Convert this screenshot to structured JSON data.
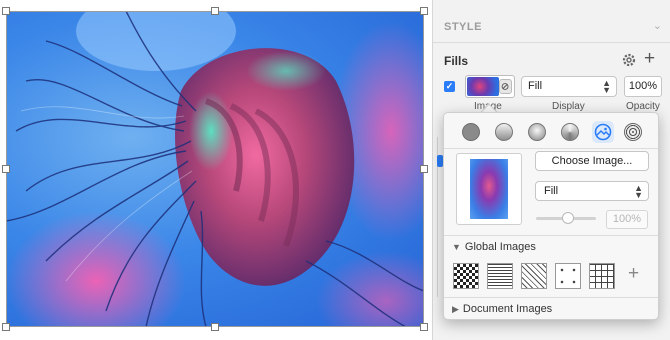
{
  "inspector": {
    "section_title": "STYLE",
    "fills_title": "Fills",
    "fill_row": {
      "enabled": true,
      "type_value": "Fill",
      "opacity_value": "100%",
      "label_image": "Image",
      "label_display": "Display",
      "label_opacity": "Opacity"
    }
  },
  "popover": {
    "fill_types": [
      "solid-color",
      "linear-gradient",
      "radial-gradient",
      "angular-gradient",
      "image-fill",
      "noise-fill"
    ],
    "selected_fill_type": "image-fill",
    "choose_image_label": "Choose Image...",
    "display_mode": "Fill",
    "opacity_placeholder": "100%",
    "global_images_label": "Global Images",
    "document_images_label": "Document Images"
  },
  "colors": {
    "accent": "#2a7cf7",
    "panel_bg": "#f2f2f2"
  }
}
